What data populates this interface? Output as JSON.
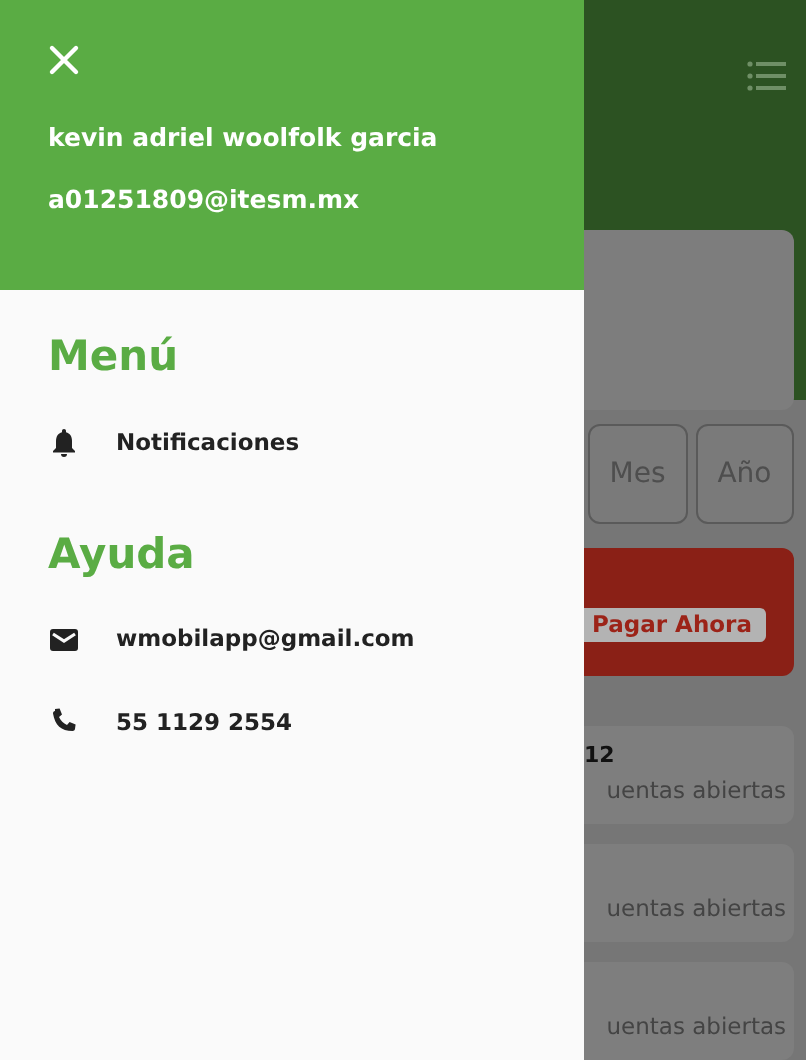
{
  "drawer": {
    "user_name": "kevin adriel woolfolk garcia",
    "user_email": "a01251809@itesm.mx",
    "sections": [
      {
        "title": "Menú",
        "items": [
          {
            "kind": "bell",
            "label": "Notificaciones"
          }
        ]
      },
      {
        "title": "Ayuda",
        "items": [
          {
            "kind": "mail",
            "label": "wmobilapp@gmail.com"
          },
          {
            "kind": "phone",
            "label": "55 1129 2554"
          }
        ]
      }
    ]
  },
  "background": {
    "period_tabs": [
      {
        "label": "Mes"
      },
      {
        "label": "Año"
      }
    ],
    "pay_button": "Pagar Ahora",
    "account_cards": [
      {
        "count": "12",
        "label": "uentas abiertas"
      },
      {
        "label": "uentas abiertas"
      },
      {
        "label": "uentas abiertas"
      }
    ]
  }
}
